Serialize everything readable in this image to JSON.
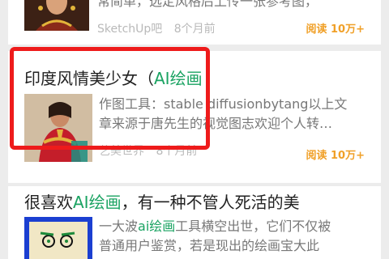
{
  "articles": [
    {
      "excerpt_line": "常简单，选定风格后上传一张参考图，",
      "source": "SketchUp吧",
      "time": "8个月前",
      "reads": "阅读 10万+"
    },
    {
      "title_prefix": "印度风情美少女（",
      "title_highlight": "AI绘画",
      "excerpt_line1": "作图工具：stable diffusionbytang以上文",
      "excerpt_line2": "章来源于唐先生的视觉图志欢迎个人转…",
      "source": "艺美世界",
      "time": "8个月前",
      "reads": "阅读 10万+"
    },
    {
      "title_prefix": "很喜欢",
      "title_highlight": "AI绘画",
      "title_suffix": "，有一种不管人死活的美",
      "excerpt_line1_prefix": "一大波",
      "excerpt_line1_highlight": "ai绘画",
      "excerpt_line1_suffix": "工具横空出世，它们不仅被",
      "excerpt_line2": "普通用户鉴赏，若是现出的绘画宝大此"
    }
  ],
  "colors": {
    "highlight_text": "#1aa362",
    "reads_text": "#f0a028",
    "annotation_box": "#ee1b1b"
  }
}
